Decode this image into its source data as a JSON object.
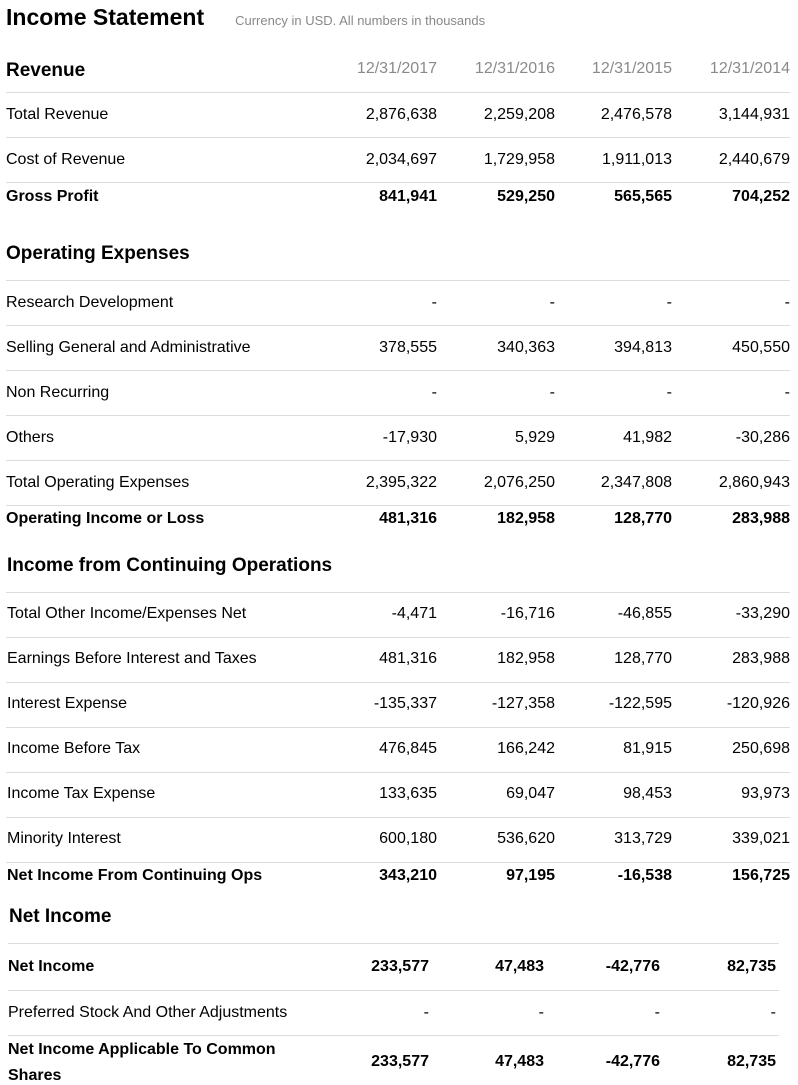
{
  "header": {
    "title": "Income Statement",
    "subtitle": "Currency in USD. All numbers in thousands"
  },
  "dates": [
    "12/31/2017",
    "12/31/2016",
    "12/31/2015",
    "12/31/2014"
  ],
  "sections": {
    "revenue": "Revenue",
    "operating_expenses": "Operating Expenses",
    "continuing_ops": "Income from Continuing Operations",
    "net_income": "Net Income"
  },
  "rows": {
    "total_revenue": {
      "label": "Total Revenue",
      "values": [
        "2,876,638",
        "2,259,208",
        "2,476,578",
        "3,144,931"
      ]
    },
    "cost_of_revenue": {
      "label": "Cost of Revenue",
      "values": [
        "2,034,697",
        "1,729,958",
        "1,911,013",
        "2,440,679"
      ]
    },
    "gross_profit": {
      "label": "Gross Profit",
      "values": [
        "841,941",
        "529,250",
        "565,565",
        "704,252"
      ]
    },
    "research_development": {
      "label": "Research Development",
      "values": [
        "-",
        "-",
        "-",
        "-"
      ]
    },
    "sga": {
      "label": "Selling General and Administrative",
      "values": [
        "378,555",
        "340,363",
        "394,813",
        "450,550"
      ]
    },
    "non_recurring": {
      "label": "Non Recurring",
      "values": [
        "-",
        "-",
        "-",
        "-"
      ]
    },
    "others": {
      "label": "Others",
      "values": [
        "-17,930",
        "5,929",
        "41,982",
        "-30,286"
      ]
    },
    "total_operating_expenses": {
      "label": "Total Operating Expenses",
      "values": [
        "2,395,322",
        "2,076,250",
        "2,347,808",
        "2,860,943"
      ]
    },
    "operating_income": {
      "label": "Operating Income or Loss",
      "values": [
        "481,316",
        "182,958",
        "128,770",
        "283,988"
      ]
    },
    "total_other_income": {
      "label": "Total Other Income/Expenses Net",
      "values": [
        "-4,471",
        "-16,716",
        "-46,855",
        "-33,290"
      ]
    },
    "ebit": {
      "label": "Earnings Before Interest and Taxes",
      "values": [
        "481,316",
        "182,958",
        "128,770",
        "283,988"
      ]
    },
    "interest_expense": {
      "label": "Interest Expense",
      "values": [
        "-135,337",
        "-127,358",
        "-122,595",
        "-120,926"
      ]
    },
    "income_before_tax": {
      "label": "Income Before Tax",
      "values": [
        "476,845",
        "166,242",
        "81,915",
        "250,698"
      ]
    },
    "income_tax_expense": {
      "label": "Income Tax Expense",
      "values": [
        "133,635",
        "69,047",
        "98,453",
        "93,973"
      ]
    },
    "minority_interest": {
      "label": "Minority Interest",
      "values": [
        "600,180",
        "536,620",
        "313,729",
        "339,021"
      ]
    },
    "net_income_continuing": {
      "label": "Net Income From Continuing Ops",
      "values": [
        "343,210",
        "97,195",
        "-16,538",
        "156,725"
      ]
    },
    "net_income": {
      "label": "Net Income",
      "values": [
        "233,577",
        "47,483",
        "-42,776",
        "82,735"
      ]
    },
    "preferred_stock": {
      "label": "Preferred Stock And Other Adjustments",
      "values": [
        "-",
        "-",
        "-",
        "-"
      ]
    },
    "net_income_common": {
      "label_line1": "Net Income Applicable To Common",
      "label_line2": "Shares",
      "values": [
        "233,577",
        "47,483",
        "-42,776",
        "82,735"
      ]
    }
  }
}
